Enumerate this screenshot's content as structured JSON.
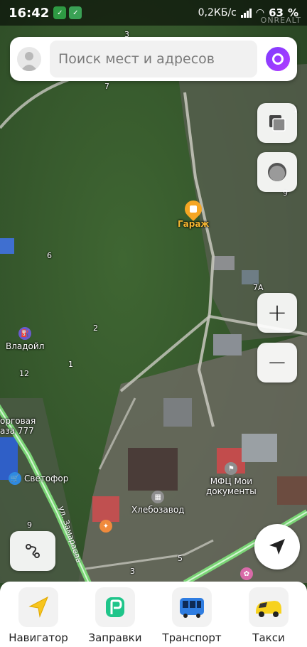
{
  "status_bar": {
    "time": "16:42",
    "network_speed": "0,2КБ/с",
    "battery": "63",
    "watermark": "ONREALT"
  },
  "search": {
    "placeholder": "Поиск мест и адресов"
  },
  "map": {
    "house_numbers": [
      "3",
      "7",
      "1",
      "6",
      "7А",
      "2",
      "1",
      "12",
      "9",
      "9",
      "5",
      "3"
    ],
    "street_name": "ул. Замараева",
    "pois": {
      "garage": "Гараж",
      "vladoil": "Владойл",
      "svetofor": "Светофор",
      "mfc_line1": "МФЦ Мои",
      "mfc_line2": "документы",
      "bakery": "Хлебозавод",
      "trade_base_line1": "орговая",
      "trade_base_line2": "аза 777"
    }
  },
  "controls": {
    "zoom_in": "+",
    "zoom_out": "−"
  },
  "bottom_nav": [
    {
      "label": "Навигатор",
      "icon": "navigator-icon"
    },
    {
      "label": "Заправки",
      "icon": "fuel-icon"
    },
    {
      "label": "Транспорт",
      "icon": "bus-icon"
    },
    {
      "label": "Такси",
      "icon": "taxi-icon"
    }
  ],
  "colors": {
    "vegetation": "#3a5e2f",
    "road_highlight": "#7ee07a",
    "poi_orange": "#f5a623",
    "alice_purple": "#8a3cff"
  }
}
